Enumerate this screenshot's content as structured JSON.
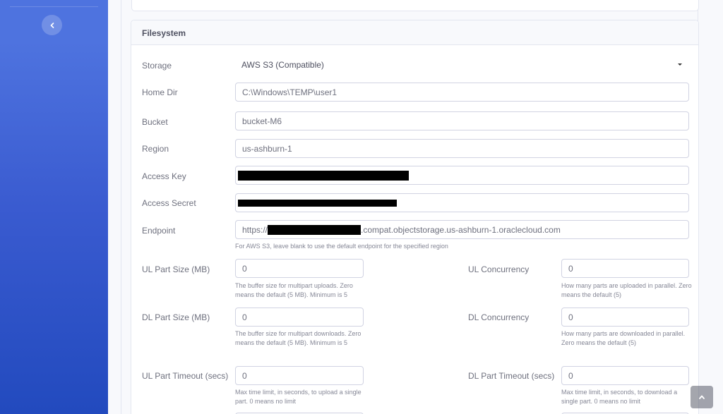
{
  "sidebar": {
    "toggle_icon": "chevron-left-icon"
  },
  "filesystem": {
    "title": "Filesystem",
    "storage": {
      "label": "Storage",
      "value": "AWS S3 (Compatible)"
    },
    "home_dir": {
      "label": "Home Dir",
      "value": "C:\\Windows\\TEMP\\user1"
    },
    "bucket": {
      "label": "Bucket",
      "value": "bucket-M6"
    },
    "region": {
      "label": "Region",
      "value": "us-ashburn-1"
    },
    "access_key": {
      "label": "Access Key"
    },
    "access_secret": {
      "label": "Access Secret"
    },
    "endpoint": {
      "label": "Endpoint",
      "prefix": "https://",
      "suffix": ".compat.objectstorage.us-ashburn-1.oraclecloud.com",
      "help": "For AWS S3, leave blank to use the default endpoint for the specified region"
    },
    "ul_part_size": {
      "label": "UL Part Size (MB)",
      "value": "0",
      "help": "The buffer size for multipart uploads. Zero means the default (5 MB). Minimum is 5"
    },
    "ul_concurrency": {
      "label": "UL Concurrency",
      "value": "0",
      "help": "How many parts are uploaded in parallel. Zero means the default (5)"
    },
    "dl_part_size": {
      "label": "DL Part Size (MB)",
      "value": "0",
      "help": "The buffer size for multipart downloads. Zero means the default (5 MB). Minimum is 5"
    },
    "dl_concurrency": {
      "label": "DL Concurrency",
      "value": "0",
      "help": "How many parts are downloaded in parallel. Zero means the default (5)"
    },
    "ul_part_timeout": {
      "label": "UL Part Timeout (secs)",
      "value": "0",
      "help": "Max time limit, in seconds, to upload a single part. 0 means no limit"
    },
    "dl_part_timeout": {
      "label": "DL Part Timeout (secs)",
      "value": "0",
      "help": "Max time limit, in seconds, to download a single part. 0 means no limit"
    }
  },
  "scroll_top_icon": "chevron-up-icon"
}
